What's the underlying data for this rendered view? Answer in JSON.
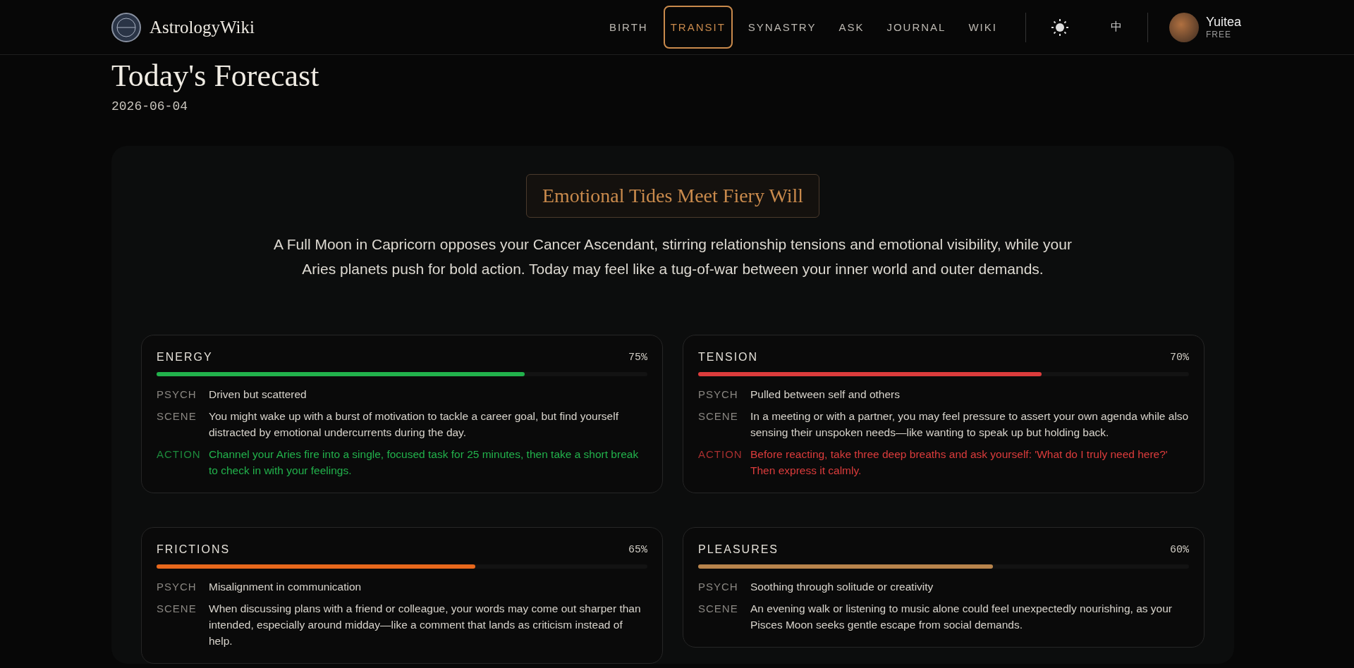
{
  "header": {
    "logo_text": "AstrologyWiki",
    "nav": [
      {
        "label": "BIRTH",
        "selected": false
      },
      {
        "label": "TRANSIT",
        "selected": true
      },
      {
        "label": "SYNASTRY",
        "selected": false
      },
      {
        "label": "ASK",
        "selected": false
      },
      {
        "label": "JOURNAL",
        "selected": false
      },
      {
        "label": "WIKI",
        "selected": false
      }
    ],
    "language": "中",
    "user": {
      "name": "Yuitea",
      "plan": "FREE"
    }
  },
  "page": {
    "title": "Today's Forecast",
    "date": "2026-06-04"
  },
  "forecast": {
    "headline": "Emotional Tides Meet Fiery Will",
    "summary": "A Full Moon in Capricorn opposes your Cancer Ascendant, stirring relationship tensions and emotional visibility, while your Aries planets push for bold action. Today may feel like a tug-of-war between your inner world and outer demands.",
    "cards": [
      {
        "title": "ENERGY",
        "percent": "75%",
        "level": 0.75,
        "color": "#22b24c",
        "rows": [
          {
            "kind": "plain",
            "label": "PSYCH",
            "text": "Driven but scattered"
          },
          {
            "kind": "plain",
            "label": "SCENE",
            "text": "You might wake up with a burst of motivation to tackle a career goal, but find yourself distracted by emotional undercurrents during the day."
          },
          {
            "kind": "action",
            "label": "ACTION",
            "text": "Channel your Aries fire into a single, focused task for 25 minutes, then take a short break to check in with your feelings."
          }
        ]
      },
      {
        "title": "TENSION",
        "percent": "70%",
        "level": 0.7,
        "color": "#dc3c3c",
        "rows": [
          {
            "kind": "plain",
            "label": "PSYCH",
            "text": "Pulled between self and others"
          },
          {
            "kind": "plain",
            "label": "SCENE",
            "text": "In a meeting or with a partner, you may feel pressure to assert your own agenda while also sensing their unspoken needs—like wanting to speak up but holding back."
          },
          {
            "kind": "action",
            "label": "ACTION",
            "text": "Before reacting, take three deep breaths and ask yourself: 'What do I truly need here?' Then express it calmly."
          }
        ]
      },
      {
        "title": "FRICTIONS",
        "percent": "65%",
        "level": 0.65,
        "color": "#e8681c",
        "rows": [
          {
            "kind": "plain",
            "label": "PSYCH",
            "text": "Misalignment in communication"
          },
          {
            "kind": "plain",
            "label": "SCENE",
            "text": "When discussing plans with a friend or colleague, your words may come out sharper than intended, especially around midday—like a comment that lands as criticism instead of help."
          }
        ]
      },
      {
        "title": "PLEASURES",
        "percent": "60%",
        "level": 0.6,
        "color": "#b8844c",
        "rows": [
          {
            "kind": "plain",
            "label": "PSYCH",
            "text": "Soothing through solitude or creativity"
          },
          {
            "kind": "plain",
            "label": "SCENE",
            "text": "An evening walk or listening to music alone could feel unexpectedly nourishing, as your Pisces Moon seeks gentle escape from social demands."
          }
        ]
      }
    ]
  }
}
